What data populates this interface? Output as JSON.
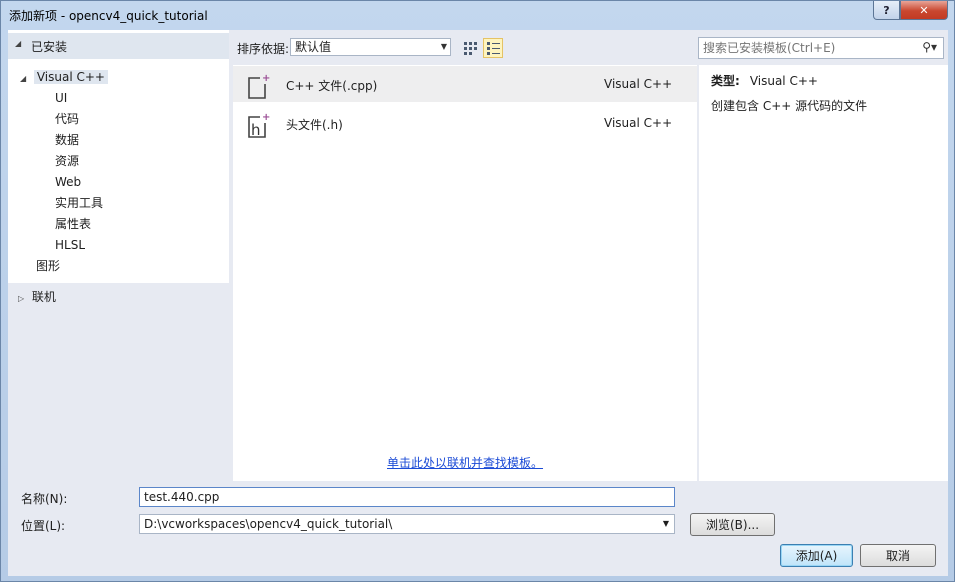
{
  "window": {
    "title": "添加新项 - opencv4_quick_tutorial",
    "help_label": "?",
    "close_label": "✕"
  },
  "tree": {
    "installed_label": "已安装",
    "root": {
      "label": "Visual C++",
      "children": [
        "UI",
        "代码",
        "数据",
        "资源",
        "Web",
        "实用工具",
        "属性表",
        "HLSL"
      ]
    },
    "graphics_label": "图形",
    "online_label": "联机"
  },
  "toolbar": {
    "sort_label": "排序依据:",
    "sort_value": "默认值"
  },
  "templates": [
    {
      "name": "C++ 文件(.cpp)",
      "lang": "Visual C++",
      "selected": true,
      "icon": "cpp-file-icon"
    },
    {
      "name": "头文件(.h)",
      "lang": "Visual C++",
      "selected": false,
      "icon": "header-file-icon"
    }
  ],
  "online_link": "单击此处以联机并查找模板。",
  "search": {
    "placeholder": "搜索已安装模板(Ctrl+E)"
  },
  "details": {
    "type_label": "类型:",
    "type_value": "Visual C++",
    "description": "创建包含 C++ 源代码的文件"
  },
  "form": {
    "name_label": "名称(N):",
    "name_value": "test.440.cpp",
    "location_label": "位置(L):",
    "location_value": "D:\\vcworkspaces\\opencv4_quick_tutorial\\",
    "browse_label": "浏览(B)...",
    "add_label": "添加(A)",
    "cancel_label": "取消"
  },
  "colors": {
    "selection": "#dfe6ef",
    "link": "#1b4bd6",
    "panel": "#e7eaf2",
    "title_bg": "#b9d1ea"
  }
}
